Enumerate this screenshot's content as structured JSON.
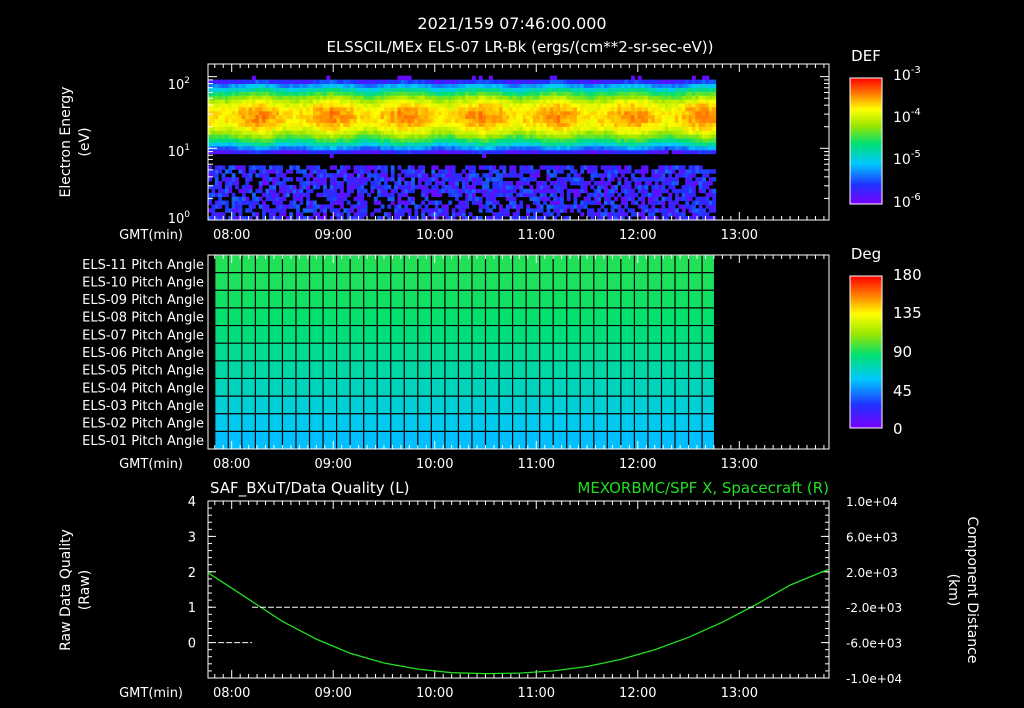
{
  "header": {
    "timestamp": "2021/159 07:46:00.000",
    "subtitle": "ELSSCIL/MEx ELS-07 LR-Bk  (ergs/(cm**2-sr-sec-eV))"
  },
  "time_axis": {
    "label": "GMT(min)",
    "ticks": [
      "08:00",
      "09:00",
      "10:00",
      "11:00",
      "12:00",
      "13:00"
    ],
    "tick_minutes": [
      480,
      540,
      600,
      660,
      720,
      780
    ],
    "range_minutes": [
      466,
      833
    ],
    "data_end_minutes": 765
  },
  "colors": {
    "background": "#000000",
    "foreground": "#ffffff",
    "data_quality": "#ffffff",
    "spacecraft_x": "#22dd22",
    "colorbar_stops": [
      "#7a00ff",
      "#2030ff",
      "#00c8ff",
      "#00e070",
      "#9be600",
      "#ffff00",
      "#ff8000",
      "#ff0000"
    ]
  },
  "chart_data": [
    {
      "type": "heatmap",
      "title": "ELSSCIL/MEx ELS-07 LR-Bk  (ergs/(cm**2-sr-sec-eV))",
      "ylabel": "Electron Energy (eV)",
      "ylabel_lines": [
        "Electron Energy",
        "(eV)"
      ],
      "y_scale": "log",
      "ylim": [
        1,
        150
      ],
      "y_ticks": [
        {
          "base": "10",
          "exp": "0"
        },
        {
          "base": "10",
          "exp": "1"
        },
        {
          "base": "10",
          "exp": "2"
        }
      ],
      "colorbar": {
        "label": "DEF",
        "scale": "log",
        "range": [
          5e-07,
          0.001
        ],
        "ticks": [
          {
            "base": "10",
            "exp": "-3"
          },
          {
            "base": "10",
            "exp": "-4"
          },
          {
            "base": "10",
            "exp": "-5"
          },
          {
            "base": "10",
            "exp": "-6"
          }
        ]
      },
      "data_time_range_minutes": [
        466,
        765
      ],
      "peak_energy_eV": 28,
      "values_description_range": [
        1e-06,
        0.0003
      ]
    },
    {
      "type": "heatmap",
      "rows": [
        "ELS-11 Pitch Angle",
        "ELS-10 Pitch Angle",
        "ELS-09 Pitch Angle",
        "ELS-08 Pitch Angle",
        "ELS-07 Pitch Angle",
        "ELS-06 Pitch Angle",
        "ELS-05 Pitch Angle",
        "ELS-04 Pitch Angle",
        "ELS-03 Pitch Angle",
        "ELS-02 Pitch Angle",
        "ELS-01 Pitch Angle"
      ],
      "row_values_deg": [
        92,
        91,
        89,
        87,
        84,
        80,
        76,
        71,
        66,
        61,
        56
      ],
      "colorbar": {
        "label": "Deg",
        "range": [
          0,
          180
        ],
        "ticks": [
          "180",
          "135",
          "90",
          "45",
          "0"
        ]
      },
      "data_time_range_minutes": [
        470,
        765
      ]
    },
    {
      "type": "line",
      "title_left": "SAF_BXuT/Data Quality (L)",
      "title_right": "MEXORBMC/SPF X, Spacecraft (R)",
      "ylabel_left_lines": [
        "Raw Data Quality",
        "(Raw)"
      ],
      "ylabel_right_lines": [
        "Component Distance",
        "(km)"
      ],
      "ylim_left": [
        -1,
        4
      ],
      "y_ticks_left": [
        "4",
        "3",
        "2",
        "1",
        "0"
      ],
      "ylim_right": [
        -10000,
        10000
      ],
      "y_ticks_right": [
        "1.0e+04",
        "6.0e+03",
        "2.0e+03",
        "-2.0e+03",
        "-6.0e+03",
        "-1.0e+04"
      ],
      "series": [
        {
          "name": "MEXORBMC/SPF X, Spacecraft (R)",
          "axis": "right",
          "x_minutes": [
            466,
            490,
            510,
            530,
            550,
            570,
            590,
            610,
            630,
            650,
            670,
            690,
            710,
            730,
            750,
            770,
            790,
            810,
            833
          ],
          "values": [
            1900,
            -1100,
            -3600,
            -5600,
            -7200,
            -8300,
            -9000,
            -9400,
            -9500,
            -9450,
            -9200,
            -8700,
            -7900,
            -6800,
            -5400,
            -3700,
            -1700,
            500,
            2300
          ]
        },
        {
          "name": "SAF_BXuT/Data Quality (L)",
          "axis": "left",
          "segments": [
            {
              "x_minutes": [
                472,
                492
              ],
              "values": [
                0,
                0
              ]
            },
            {
              "x_minutes": [
                492,
                827
              ],
              "values": [
                1,
                1
              ]
            }
          ]
        }
      ]
    }
  ]
}
